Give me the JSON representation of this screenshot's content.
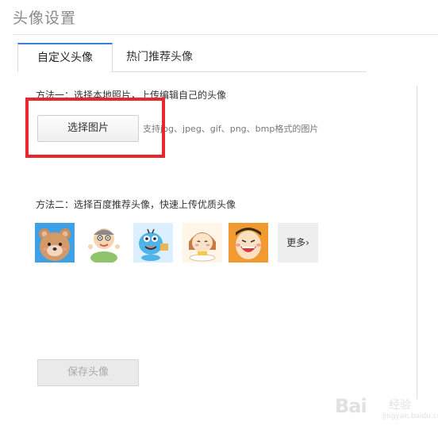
{
  "header": {
    "title": "头像设置"
  },
  "tabs": [
    {
      "label": "自定义头像",
      "active": true
    },
    {
      "label": "热门推荐头像",
      "active": false
    }
  ],
  "method1": {
    "text": "方法一：选择本地照片，上传编辑自己的头像",
    "button_label": "选择图片",
    "format_hint": "支持jpg、jpeg、gif、png、bmp格式的图片"
  },
  "method2": {
    "text": "方法二：选择百度推荐头像，快速上传优质头像",
    "avatars": [
      "bear-avatar",
      "cartoon-boy-avatar",
      "blue-creature-avatar",
      "girl-eating-avatar",
      "laughing-face-avatar"
    ],
    "more_label": "更多›"
  },
  "save_label": "保存头像",
  "watermark": {
    "brand": "Bai",
    "sub": "经验",
    "url": "jingyan.baidu.com"
  },
  "colors": {
    "accent": "#3a7fd5",
    "highlight": "#e8262b"
  }
}
